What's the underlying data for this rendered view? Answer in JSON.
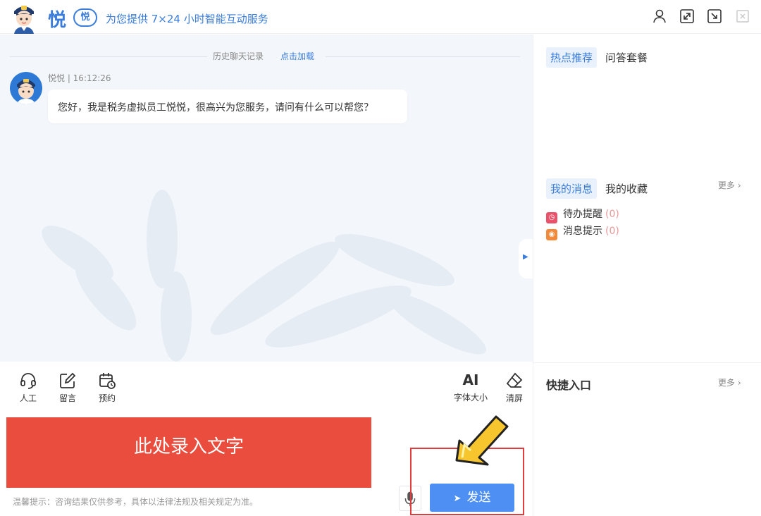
{
  "header": {
    "brand_name": "悦",
    "brand_badge": "悦",
    "slogan": "为您提供 7×24 小时智能互动服务",
    "icons": [
      "user-icon",
      "expand-icon",
      "popout-icon",
      "close-icon"
    ]
  },
  "chat": {
    "history_label": "历史聊天记录",
    "history_link": "点击加载",
    "messages": [
      {
        "sender": "悦悦",
        "time": "16:12:26",
        "meta": "悦悦 | 16:12:26",
        "text": "您好，我是税务虚拟员工悦悦，很高兴为您服务，请问有什么可以帮您？"
      }
    ],
    "collapse_icon": "▶"
  },
  "right_panel": {
    "hot_tabs": [
      {
        "label": "热点推荐",
        "active": true
      },
      {
        "label": "问答套餐",
        "active": false
      }
    ],
    "msg_tabs": [
      {
        "label": "我的消息",
        "active": true
      },
      {
        "label": "我的收藏",
        "active": false
      }
    ],
    "msg_more": "更多 ›",
    "messages": [
      {
        "label": "待办提醒",
        "count": "(0)",
        "icon": "clock-icon",
        "color": "#e9526a"
      },
      {
        "label": "消息提示",
        "count": "(0)",
        "icon": "bell-icon",
        "color": "#f28a3a"
      }
    ],
    "quick_title": "快捷入口",
    "quick_more": "更多 ›"
  },
  "toolbar": {
    "tools": [
      {
        "label": "人工",
        "icon": "headset-icon"
      },
      {
        "label": "留言",
        "icon": "edit-icon"
      },
      {
        "label": "预约",
        "icon": "calendar-clock-icon"
      }
    ],
    "font_icon_text": "AI",
    "font_size_label": "字体大小",
    "clear_label": "清屏"
  },
  "input": {
    "placeholder_overlay": "此处录入文字",
    "send_label": "发送",
    "send_arrow": "➤",
    "tip": "温馨提示：咨询结果仅供参考，具体以法律法规及相关规定为准。"
  },
  "colors": {
    "accent": "#3a7ddc",
    "send": "#4d8ff2",
    "input_highlight": "#ea4d3e",
    "annotation_border": "#e23b3b",
    "annotation_arrow": "#f7c62f"
  }
}
